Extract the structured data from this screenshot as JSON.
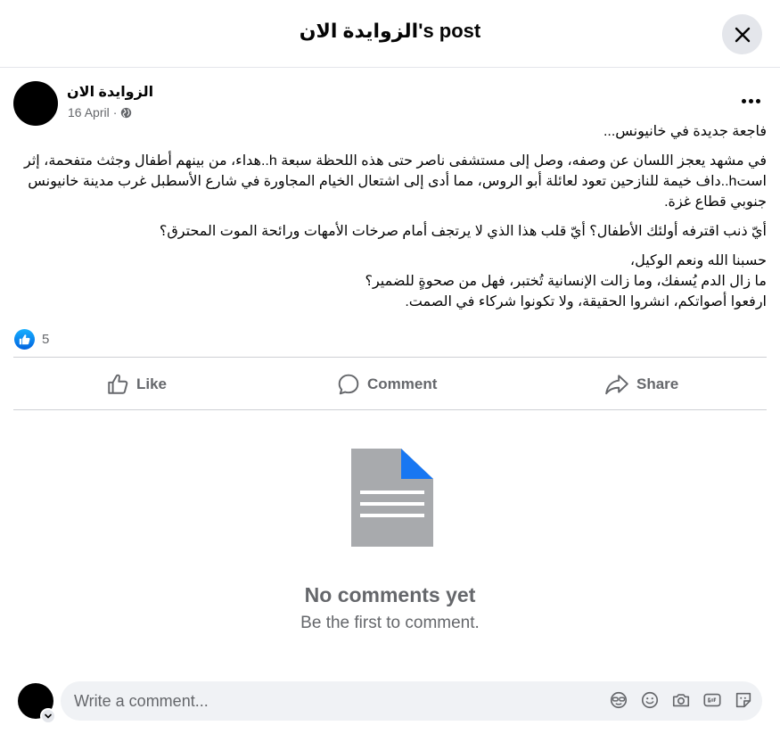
{
  "dialog": {
    "title": "الزوايدة الان's post"
  },
  "post": {
    "author": "الزوايدة الان",
    "date": "16 April",
    "paragraphs": [
      "فاجعة جديدة في خانيونس...",
      "في مشهد يعجز اللسان عن وصفه، وصل إلى مستشفى ناصر حتى هذه اللحظة سبعة h..هداء، من بينهم أطفال وجثث متفحمة، إثر استh..داف خيمة للنازحين تعود لعائلة أبو الروس، مما أدى إلى اشتعال الخيام المجاورة في شارع الأسطبل غرب مدينة خانيونس جنوبي قطاع غزة.",
      "أيّ ذنب اقترفه أولئك الأطفال؟ أيّ قلب هذا الذي لا يرتجف أمام صرخات الأمهات ورائحة الموت المحترق؟",
      "حسبنا الله ونعم الوكيل،\nما زال الدم يُسفك، وما زالت الإنسانية تُختبر، فهل من صحوةٍ للضمير؟\nارفعوا أصواتكم، انشروا الحقيقة، ولا تكونوا شركاء في الصمت."
    ],
    "reaction_count": "5"
  },
  "actions": {
    "like": "Like",
    "comment": "Comment",
    "share": "Share"
  },
  "comments": {
    "empty_title": "No comments yet",
    "empty_subtitle": "Be the first to comment."
  },
  "composer": {
    "placeholder": "Write a comment..."
  },
  "colors": {
    "accent": "#0866ff",
    "secondary_text": "#65676b",
    "divider": "#ced0d4",
    "doc_icon": "#a8aaad"
  },
  "icons": [
    "close-icon",
    "globe-icon",
    "more-icon",
    "like-reaction-icon",
    "like-icon",
    "comment-icon",
    "share-icon",
    "document-icon",
    "chevron-down-icon",
    "avatar-sticker-icon",
    "emoji-icon",
    "camera-icon",
    "gif-icon",
    "sticker-icon"
  ]
}
